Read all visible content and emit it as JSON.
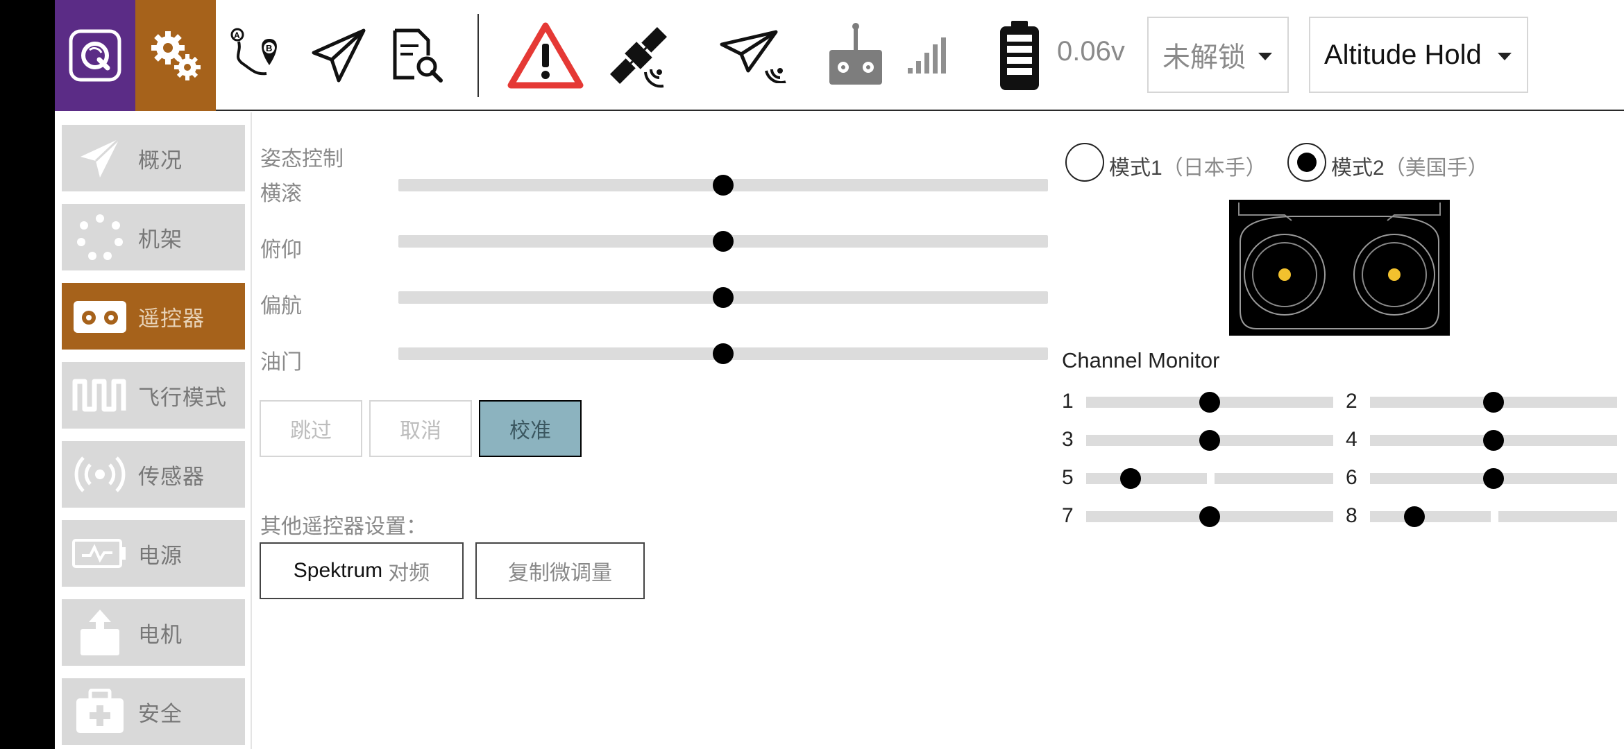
{
  "toolbar": {
    "icons": [
      "qgc-logo-icon",
      "settings-gears-icon",
      "plan-route-icon",
      "fly-view-icon",
      "analyze-log-icon",
      "warning-icon",
      "gps-satellite-icon",
      "telemetry-icon",
      "rc-transmitter-icon",
      "signal-bars-icon",
      "battery-icon"
    ],
    "battery_voltage": "0.06v",
    "arm_state": "未解锁",
    "flight_mode": "Altitude Hold"
  },
  "sidebar": {
    "items": [
      {
        "label": "概况",
        "icon": "plane-icon"
      },
      {
        "label": "机架",
        "icon": "frame-dots-icon"
      },
      {
        "label": "遥控器",
        "icon": "remote-control-icon",
        "active": true
      },
      {
        "label": "飞行模式",
        "icon": "flight-mode-wave-icon"
      },
      {
        "label": "传感器",
        "icon": "sensor-radar-icon"
      },
      {
        "label": "电源",
        "icon": "power-battery-icon"
      },
      {
        "label": "电机",
        "icon": "motor-icon"
      },
      {
        "label": "安全",
        "icon": "safety-medkit-icon"
      }
    ]
  },
  "attitude": {
    "title": "姿态控制",
    "axes": [
      {
        "label": "横滚",
        "value": 0.5
      },
      {
        "label": "俯仰",
        "value": 0.5
      },
      {
        "label": "偏航",
        "value": 0.5
      },
      {
        "label": "油门",
        "value": 0.5
      }
    ],
    "skip_label": "跳过",
    "cancel_label": "取消",
    "calibrate_label": "校准"
  },
  "other": {
    "title": "其他遥控器设置：",
    "spektrum_bold": "Spektrum",
    "spektrum_label": "对频",
    "copy_trims_label": "复制微调量"
  },
  "mode": {
    "mode1_num": "模式1",
    "mode1_desc": "（日本手）",
    "mode2_num": "模式2",
    "mode2_desc": "（美国手）",
    "selected": 2
  },
  "channel_monitor": {
    "title": "Channel Monitor",
    "channels": [
      {
        "num": "1",
        "value": 0.5
      },
      {
        "num": "2",
        "value": 0.5
      },
      {
        "num": "3",
        "value": 0.5
      },
      {
        "num": "4",
        "value": 0.5
      },
      {
        "num": "5",
        "value": 0.18
      },
      {
        "num": "6",
        "value": 0.5
      },
      {
        "num": "7",
        "value": 0.5
      },
      {
        "num": "8",
        "value": 0.18
      }
    ]
  },
  "colors": {
    "brand_purple": "#5b2c86",
    "active_orange": "#a6621b",
    "calibrate_teal": "#8cb3bf",
    "stick_dot": "#f2c12e",
    "warning_red": "#e53935"
  }
}
